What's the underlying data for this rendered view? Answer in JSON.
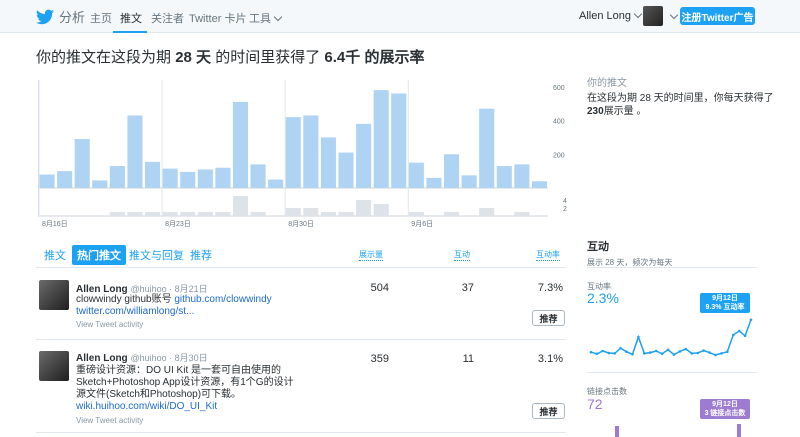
{
  "nav": {
    "brand": "分析",
    "items": [
      "主页",
      "推文",
      "关注者",
      "Twitter 卡片",
      "工具"
    ],
    "user": "Allen Long",
    "ad_button": "注册Twitter广告"
  },
  "headline": {
    "prefix": "你的推文在这段为期",
    "days": "28 天",
    "middle": "的时间里获得了",
    "impressions": "6.4千",
    "suffix": "的展示率"
  },
  "summary": {
    "title": "你的推文",
    "line1": "在这段为期 28 天的时间里，你每天获得了",
    "daily": "230",
    "line2": "展示量 。"
  },
  "chart_data": {
    "type": "bar",
    "x_labels": [
      "8月16日",
      "8月23日",
      "8月30日",
      "9月6日"
    ],
    "impressions": [
      80,
      100,
      290,
      45,
      130,
      430,
      155,
      115,
      95,
      110,
      120,
      510,
      140,
      50,
      420,
      430,
      300,
      210,
      380,
      580,
      560,
      150,
      60,
      200,
      75,
      470,
      130,
      140,
      40
    ],
    "engagements": [
      0,
      0,
      0,
      0,
      1,
      1,
      1,
      1,
      1,
      1,
      1,
      5,
      1,
      0,
      2,
      2,
      1,
      1,
      4,
      3,
      0,
      1,
      0,
      1,
      0,
      2,
      0,
      1,
      0
    ],
    "y_ticks_top": [
      "600",
      "400",
      "200"
    ],
    "y_ticks_bottom": [
      "4",
      "2"
    ],
    "ylim_top": [
      0,
      640
    ],
    "ylim_bottom": [
      0,
      6
    ],
    "colors": {
      "impressions": "#afd4f3",
      "engagements": "#dde3e8"
    }
  },
  "tabs": [
    "推文",
    "热门推文",
    "推文与回复",
    "推荐"
  ],
  "columns": {
    "impressions": "展示量",
    "engagements": "互动",
    "rate": "互动率"
  },
  "tweets": [
    {
      "author": "Allen Long",
      "meta": "@huihoo · 8月21日",
      "text": "clowwindy github账号 ",
      "link1": "github.com/clowwindy",
      "link2": "twitter.com/williamlong/st...",
      "activity": "View Tweet activity",
      "impressions": "504",
      "engagements": "37",
      "rate": "7.3%",
      "promote": "推荐"
    },
    {
      "author": "Allen Long",
      "meta": "@huihoo · 8月30日",
      "text": "重磅设计资源：DO UI Kit 是一套可自由使用的Sketch+Photoshop App设计资源，有1个G的设计源文件(Sketch和Photoshop)可下载。",
      "link1": "wiki.huihoo.com/wiki/DO_UI_Kit",
      "link2": "",
      "activity": "View Tweet activity",
      "impressions": "359",
      "engagements": "11",
      "rate": "3.1%",
      "promote": "推荐"
    }
  ],
  "right_panel": {
    "title": "互动",
    "subtitle": "展示 28 天，频次为每天",
    "rate_label": "互动率",
    "rate_value": "2.3%",
    "rate_tip_date": "9月12日",
    "rate_tip_value": "9.3% 互动率",
    "clicks_label": "链接点击数",
    "clicks_value": "72",
    "clicks_tip_date": "9月12日",
    "clicks_tip_value": "3 链接点击数",
    "rate_series": [
      1.2,
      0.8,
      1.5,
      1.0,
      0.9,
      2.2,
      1.3,
      0.7,
      5.0,
      0.9,
      1.1,
      1.5,
      0.8,
      1.8,
      0.6,
      1.4,
      2.0,
      0.9,
      1.0,
      1.6,
      1.1,
      0.5,
      0.9,
      1.3,
      5.5,
      6.5,
      5.3,
      9.3
    ],
    "colors": {
      "rate": "#1da1f2",
      "clicks": "#9c7bd1"
    }
  }
}
